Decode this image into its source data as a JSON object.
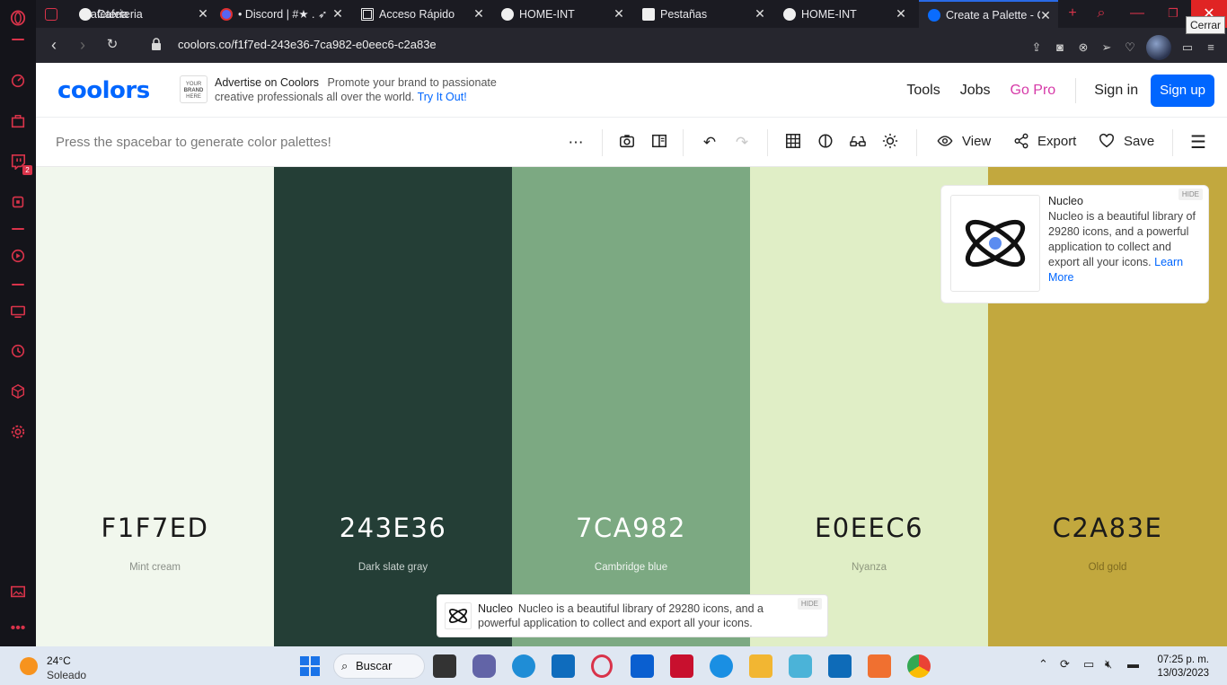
{
  "browser": {
    "tabs": [
      {
        "title": "Cafeteria"
      },
      {
        "title": "• Discord | #★ . ➶"
      },
      {
        "title": "Acceso Rápido"
      },
      {
        "title": "HOME-INT"
      },
      {
        "title": "Pestañas"
      },
      {
        "title": "HOME-INT"
      },
      {
        "title": "Create a Palette - C"
      }
    ],
    "close_tooltip": "Cerrar",
    "url": "coolors.co/f1f7ed-243e36-7ca982-e0eec6-c2a83e",
    "sidebar_badge": "2"
  },
  "header": {
    "logo": "coolors",
    "brand_box": [
      "YOUR",
      "BRAND",
      "HERE"
    ],
    "ad_title": "Advertise on Coolors",
    "ad_text": "Promote your brand to passionate creative professionals all over the world.",
    "ad_link": "Try It Out!",
    "nav": [
      "Tools",
      "Jobs",
      "Go Pro"
    ],
    "sign_in": "Sign in",
    "sign_up": "Sign up"
  },
  "toolbar": {
    "hint": "Press the spacebar to generate color palettes!",
    "view": "View",
    "export": "Export",
    "save": "Save"
  },
  "palette": [
    {
      "hex": "F1F7ED",
      "name": "Mint cream",
      "color": "#F1F7ED",
      "text": "#1a1a1a",
      "sub": "#8a8f88"
    },
    {
      "hex": "243E36",
      "name": "Dark slate gray",
      "color": "#243E36",
      "text": "#ffffff",
      "sub": "#c9d2cf"
    },
    {
      "hex": "7CA982",
      "name": "Cambridge blue",
      "color": "#7CA982",
      "text": "#ffffff",
      "sub": "#eef4ef"
    },
    {
      "hex": "E0EEC6",
      "name": "Nyanza",
      "color": "#E0EEC6",
      "text": "#1a1a1a",
      "sub": "#8e977e"
    },
    {
      "hex": "C2A83E",
      "name": "Old gold",
      "color": "#C2A83E",
      "text": "#1a1a1a",
      "sub": "#7d6a20"
    }
  ],
  "ad_card": {
    "title": "Nucleo",
    "body": "Nucleo is a beautiful library of 29280 icons, and a powerful application to collect and export all your icons.",
    "link": "Learn More",
    "hide": "HIDE"
  },
  "banner": {
    "title": "Nucleo",
    "body": "Nucleo is a beautiful library of 29280 icons, and a powerful application to collect and export all your icons.",
    "hide": "HIDE"
  },
  "taskbar": {
    "temp": "24°C",
    "weather": "Soleado",
    "search": "Buscar",
    "time": "07:25 p. m.",
    "date": "13/03/2023"
  },
  "colors": {
    "accent": "#0066ff",
    "pro": "#d63aa8",
    "opera_red": "#d9334a"
  }
}
